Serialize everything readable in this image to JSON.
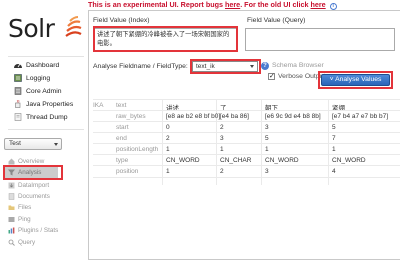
{
  "banner": {
    "text": "This is an experimental UI. Report bugs ",
    "link1": "here",
    "mid": ". For the old UI click ",
    "link2": "here",
    "info_icon": "info-icon"
  },
  "logo": {
    "text": "Solr"
  },
  "nav": {
    "items": [
      {
        "label": "Dashboard",
        "icon": "dashboard-icon"
      },
      {
        "label": "Logging",
        "icon": "logging-icon"
      },
      {
        "label": "Core Admin",
        "icon": "core-admin-icon"
      },
      {
        "label": "Java Properties",
        "icon": "java-icon"
      },
      {
        "label": "Thread Dump",
        "icon": "thread-dump-icon"
      }
    ],
    "core_selector": "Test",
    "core_items": [
      {
        "label": "Overview",
        "icon": "overview-icon"
      },
      {
        "label": "Analysis",
        "icon": "analysis-icon"
      },
      {
        "label": "DataImport",
        "icon": "dataimport-icon"
      },
      {
        "label": "Documents",
        "icon": "documents-icon"
      },
      {
        "label": "Files",
        "icon": "files-icon"
      },
      {
        "label": "Ping",
        "icon": "ping-icon"
      },
      {
        "label": "Plugins / Stats",
        "icon": "plugins-icon"
      },
      {
        "label": "Query",
        "icon": "query-icon"
      }
    ]
  },
  "analysis": {
    "field_value_index_label": "Field Value (Index)",
    "field_value_index_text": "讲述了朝下紧绷的冷峰被卷入了一场宋朝国家的电影。",
    "field_value_query_label": "Field Value (Query)",
    "fieldname_label": "Analyse Fieldname / FieldType:",
    "fieldtype_value": "text_ik",
    "schema_browser_label": "Schema Browser",
    "verbose_output_label": "Verbose Output",
    "verbose_checked": true,
    "analyze_button": "Analyse Values"
  },
  "results": {
    "analyzer_label": "IKA",
    "row_keys": [
      "text",
      "raw_bytes",
      "start",
      "end",
      "positionLength",
      "type",
      "position"
    ],
    "tokens": [
      {
        "text": "讲述",
        "raw_bytes": "[e8 ae b2 e8 bf b0]",
        "start": "0",
        "end": "2",
        "positionLength": "1",
        "type": "CN_WORD",
        "position": "1"
      },
      {
        "text": "了",
        "raw_bytes": "[e4 ba 86]",
        "start": "2",
        "end": "3",
        "positionLength": "1",
        "type": "CN_CHAR",
        "position": "2"
      },
      {
        "text": "朝下",
        "raw_bytes": "[e6 9c 9d e4 b8 8b]",
        "start": "3",
        "end": "5",
        "positionLength": "1",
        "type": "CN_WORD",
        "position": "3"
      },
      {
        "text": "紧绷",
        "raw_bytes": "[e7 b4 a7 e7 bb b7]",
        "start": "5",
        "end": "7",
        "positionLength": "1",
        "type": "CN_WORD",
        "position": "4"
      }
    ]
  }
}
